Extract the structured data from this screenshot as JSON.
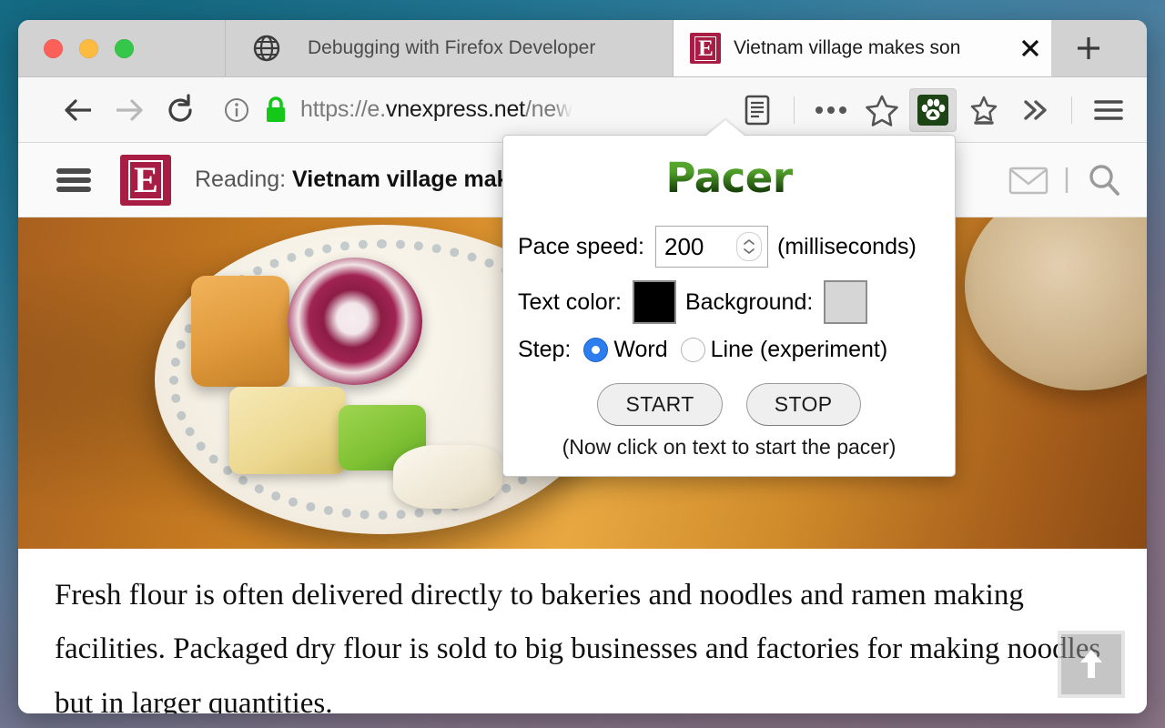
{
  "window": {
    "traffic_lights": [
      "close",
      "minimize",
      "zoom"
    ]
  },
  "tabs": [
    {
      "title": "Debugging with Firefox Developer",
      "favicon": "globe-icon",
      "active": false
    },
    {
      "title": "Vietnam village makes son",
      "favicon": "vnexpress-e-favicon",
      "active": true,
      "close_label": "✕"
    }
  ],
  "newtab_label": "+",
  "navbar": {
    "back_icon": "back-arrow-icon",
    "forward_icon": "forward-arrow-icon",
    "reload_icon": "reload-icon",
    "info_icon": "page-info-icon",
    "lock_icon": "padlock-icon",
    "url_prefix": "https://e.",
    "url_domain": "vnexpress.net",
    "url_suffix": "/new",
    "reader_icon": "reader-mode-icon",
    "page_actions_icon": "ellipsis-icon",
    "bookmark_icon": "star-icon",
    "extension_icon": "pacer-paw-extension-icon",
    "library_icon": "bookmark-library-icon",
    "overflow_icon": "double-chevron-icon",
    "menu_icon": "hamburger-menu-icon"
  },
  "site_header": {
    "menu_icon": "site-hamburger-icon",
    "logo_letter": "E",
    "reading_prefix": "Reading: ",
    "reading_title": "Vietnam village makes",
    "mail_icon": "envelope-icon",
    "search_icon": "search-icon"
  },
  "article": {
    "paragraph": "Fresh flour is often delivered directly to bakeries and noodles and ramen making facilities. Packaged dry flour is sold to big businesses and factories for making noodles but in larger quantities.",
    "scroll_top_icon": "scroll-to-top-arrow-icon"
  },
  "popup": {
    "title": "Pacer",
    "pace_speed_label": "Pace speed:",
    "pace_speed_value": "200",
    "pace_speed_unit": "(milliseconds)",
    "text_color_label": "Text color:",
    "text_color_value": "#000000",
    "background_label": "Background:",
    "background_value": "#d6d6d6",
    "step_label": "Step:",
    "step_word_label": "Word",
    "step_line_label": "Line (experiment)",
    "step_selected": "Word",
    "start_label": "START",
    "stop_label": "STOP",
    "hint": "(Now click on text to start the pacer)",
    "accent_color": "#2c7df0",
    "title_gradient_top": "#63b22f",
    "title_gradient_bottom": "#0d2f06"
  }
}
